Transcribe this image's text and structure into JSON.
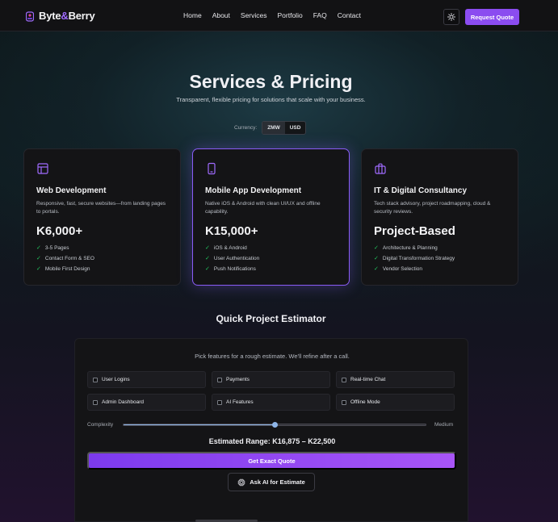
{
  "nav": {
    "brand_part1": "Byte",
    "brand_amp": "&",
    "brand_part2": "Berry",
    "links": [
      "Home",
      "About",
      "Services",
      "Portfolio",
      "FAQ",
      "Contact"
    ],
    "theme_icon": "sun-icon",
    "cta_label": "Request Quote"
  },
  "hero": {
    "title": "Services & Pricing",
    "subtitle": "Transparent, flexible pricing for solutions that scale with your business."
  },
  "currency": {
    "label": "Currency:",
    "options": [
      "ZMW",
      "USD"
    ],
    "selected": "ZMW"
  },
  "cards": [
    {
      "icon": "layout-icon",
      "title": "Web Development",
      "desc": "Responsive, fast, secure websites—from landing pages to portals.",
      "price": "K6,000+",
      "features": [
        "3-5 Pages",
        "Contact Form & SEO",
        "Mobile First Design"
      ]
    },
    {
      "icon": "smartphone-icon",
      "title": "Mobile App Development",
      "desc": "Native iOS & Android with clean UI/UX and offline capability.",
      "price": "K15,000+",
      "features": [
        "iOS & Android",
        "User Authentication",
        "Push Notifications"
      ]
    },
    {
      "icon": "briefcase-icon",
      "title": "IT & Digital Consultancy",
      "desc": "Tech stack advisory, project roadmapping, cloud & security reviews.",
      "price": "Project-Based",
      "features": [
        "Architecture & Planning",
        "Digital Transformation Strategy",
        "Vendor Selection"
      ]
    }
  ],
  "estimator": {
    "title": "Quick Project Estimator",
    "intro": "Pick features for a rough estimate. We'll refine after a call.",
    "features": [
      "User Logins",
      "Payments",
      "Real-time Chat",
      "Admin Dashboard",
      "AI Features",
      "Offline Mode"
    ],
    "complexity_label": "Complexity",
    "complexity_value": 0.5,
    "complexity_text": "Medium",
    "range_text": "Estimated Range: K16,875 – K22,500",
    "exact_btn": "Get Exact Quote",
    "ai_btn": "Ask AI for Estimate",
    "ai_icon": "cpu-icon"
  },
  "colors": {
    "accent": "#8b4cf0",
    "check": "#22c55e",
    "slider": "#8fb6e8"
  }
}
